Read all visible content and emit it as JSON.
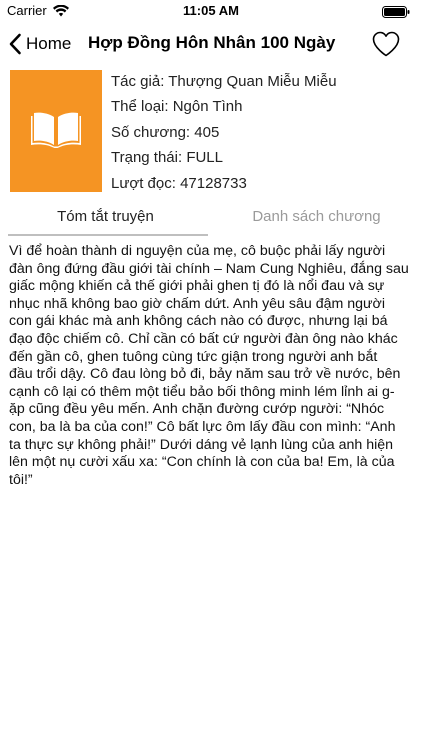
{
  "status_bar": {
    "carrier": "Carrier",
    "time": "11:05 AM"
  },
  "nav": {
    "back_label": "Home",
    "title": "Hợp Đồng Hôn Nhân 100 Ngày"
  },
  "book": {
    "cover_color": "#f59423",
    "author_line": "Tác giả: Thượng Quan Miễu Miễu",
    "genre_line": "Thể loại: Ngôn Tình",
    "chapters_line": "Số chương: 405",
    "status_line": "Trạng thái: FULL",
    "reads_line": "Lượt đọc: 47128733"
  },
  "tabs": [
    {
      "label": "Tóm tắt truyện",
      "active": true
    },
    {
      "label": "Danh sách chương",
      "active": false
    }
  ],
  "summary_text": "Vì để hoàn thành di nguyện của mẹ, cô buộc phải lấy người\nđàn ông đứng đầu giới tài chính – Nam Cung Nghiêu, đắng sau\ngiấc mộng khiến cả thế giới phải ghen tị đó là nổi đau và sự\nnhục nhã không bao giờ chấm dứt. Anh yêu sâu đậm người\ncon gái khác mà anh không cách nào có được, nhưng lại bá\nđạo độc chiếm cô. Chỉ cần có bất cứ người đàn ông nào khác\nđến gần cô, ghen tuông cùng tức giận trong người anh bắt\nđầu trổi dậy. Cô đau lòng bỏ đi, bảy năm sau trở về nước, bên\ncạnh cô lại có thêm một tiểu bảo bối thông minh lém lỉnh ai g-\nặp cũng đều yêu mến. Anh chặn đường cướp người: “Nhóc\ncon, ba là ba của con!” Cô bất lực ôm lấy đầu con mình: “Anh\nta thực sự không phải!” Dưới dáng vẻ lạnh lùng của anh hiện\nlên một nụ cười xấu xa: “Con chính là con của ba! Em, là của\ntôi!”"
}
